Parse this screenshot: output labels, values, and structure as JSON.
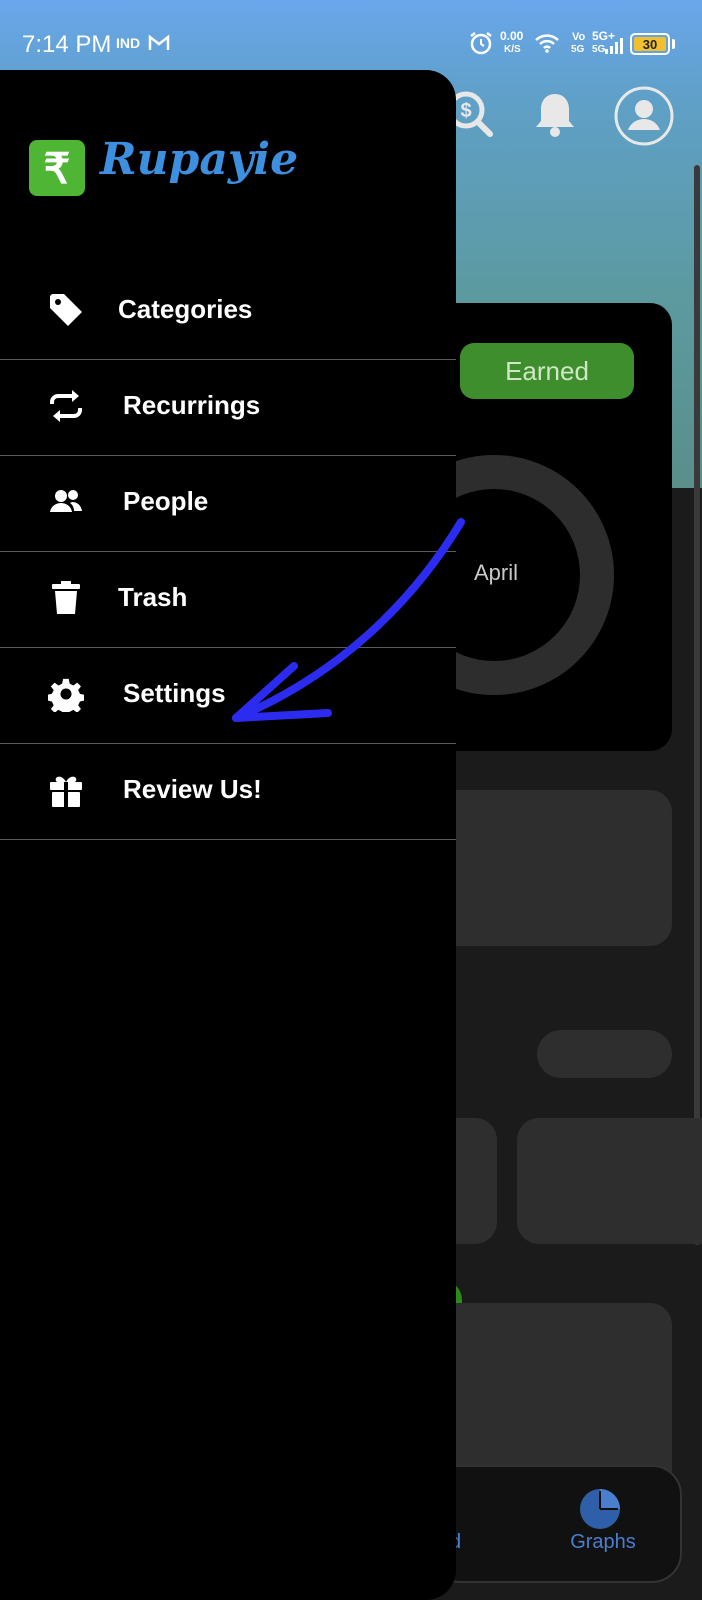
{
  "status_bar": {
    "time": "7:14 PM",
    "carrier_tag": "IND",
    "net_speed_value": "0.00",
    "net_speed_unit": "K/S",
    "volte_top": "Vo",
    "volte_bottom": "5G",
    "network_top": "5G+",
    "network_bottom": "5G",
    "battery_level": "30"
  },
  "drawer": {
    "app_name": "Rupayie",
    "logo_symbol": "₹",
    "items": [
      {
        "label": "Categories",
        "icon": "tag-icon"
      },
      {
        "label": "Recurrings",
        "icon": "repeat-icon"
      },
      {
        "label": "People",
        "icon": "people-icon"
      },
      {
        "label": "Trash",
        "icon": "trash-icon"
      },
      {
        "label": "Settings",
        "icon": "gear-icon"
      },
      {
        "label": "Review Us!",
        "icon": "gift-icon"
      }
    ]
  },
  "background": {
    "earned_tab": "Earned",
    "donut_center_label": "April",
    "nav_partial_label": "d",
    "nav_graphs_label": "Graphs"
  },
  "colors": {
    "accent_blue": "#3d8fe0",
    "logo_green": "#4fb534",
    "earned_green": "#3f8e2e",
    "annotation_arrow": "#2c2cf0"
  }
}
